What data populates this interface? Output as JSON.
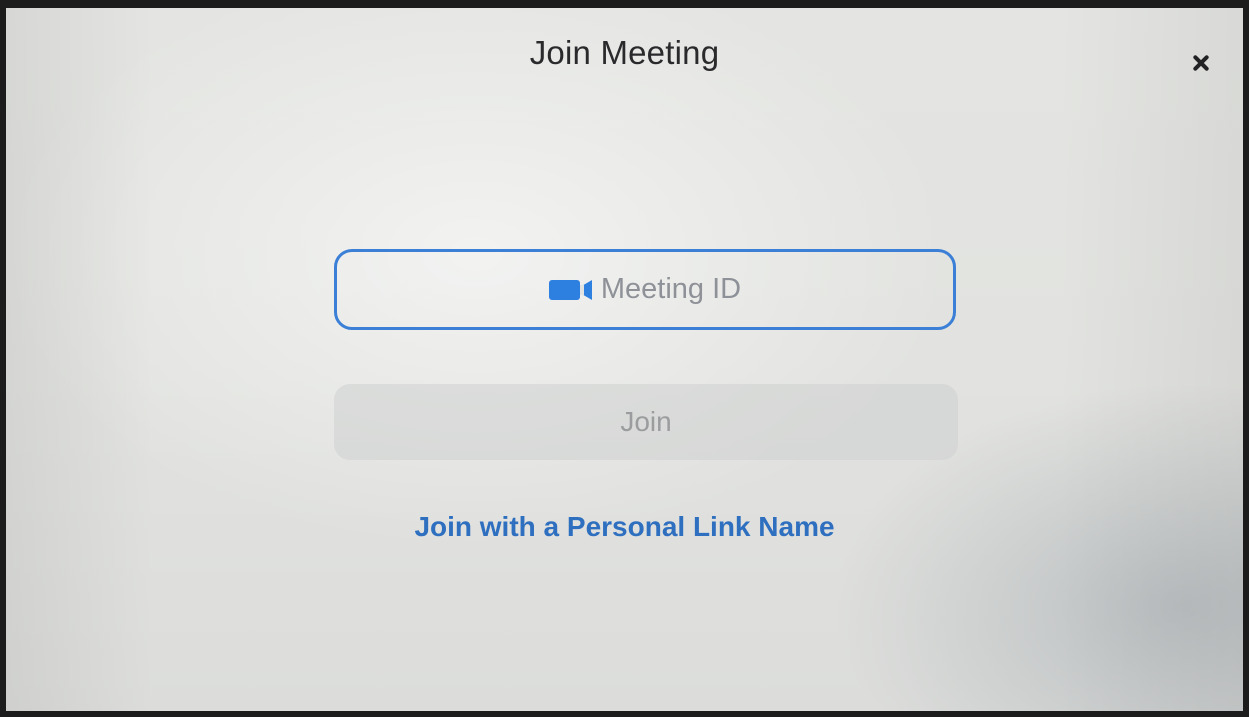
{
  "dialog": {
    "title": "Join Meeting",
    "close_icon": "close-icon"
  },
  "meeting_id_field": {
    "value": "",
    "placeholder": "Meeting ID",
    "icon": "video-camera-icon",
    "border_color": "#3b7fd6"
  },
  "join_button": {
    "label": "Join",
    "enabled": false
  },
  "personal_link": {
    "label": "Join with a Personal Link Name",
    "color": "#2f6fbf"
  }
}
